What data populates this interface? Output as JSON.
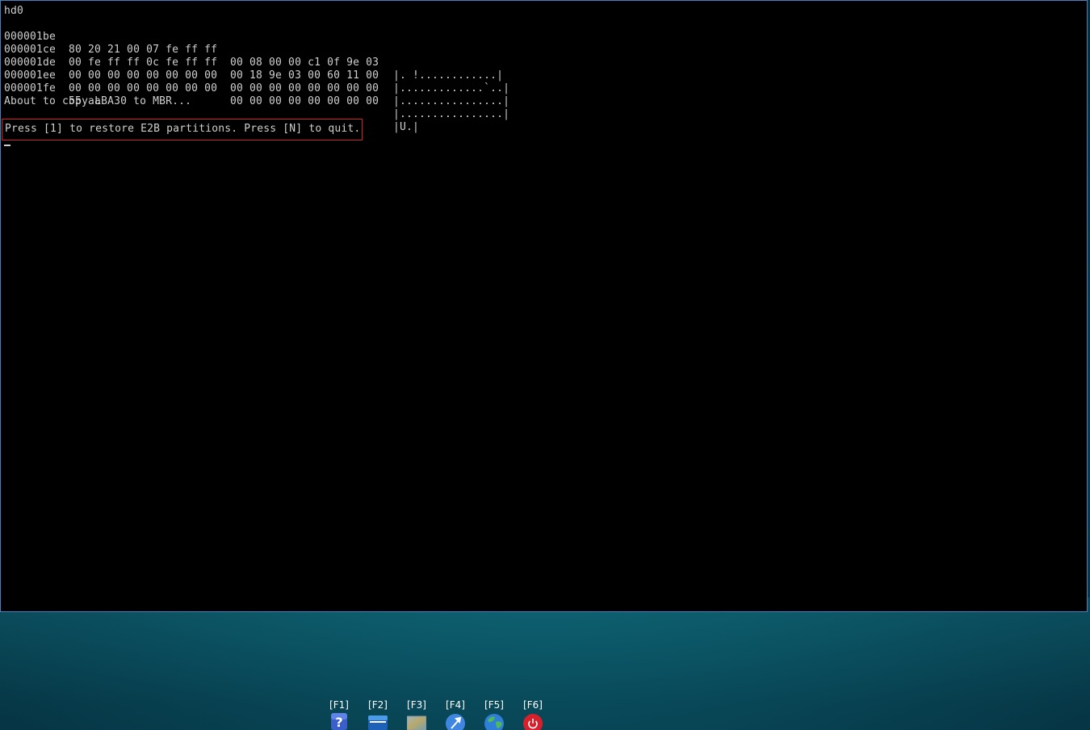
{
  "terminal": {
    "device": "hd0",
    "hexdump": [
      {
        "addr": "000001be",
        "hex1": "80 20 21 00 07 fe ff ff",
        "hex2": "00 08 00 00 c1 0f 9e 03",
        "ascii": "|. !............|"
      },
      {
        "addr": "000001ce",
        "hex1": "00 fe ff ff 0c fe ff ff",
        "hex2": "00 18 9e 03 00 60 11 00",
        "ascii": "|.............`..|"
      },
      {
        "addr": "000001de",
        "hex1": "00 00 00 00 00 00 00 00",
        "hex2": "00 00 00 00 00 00 00 00",
        "ascii": "|................|"
      },
      {
        "addr": "000001ee",
        "hex1": "00 00 00 00 00 00 00 00",
        "hex2": "00 00 00 00 00 00 00 00",
        "ascii": "|................|"
      },
      {
        "addr": "000001fe",
        "hex1": "55 aa",
        "hex2": "",
        "ascii": "|U.|"
      }
    ],
    "status_message": "About to copy LBA30 to MBR...",
    "prompt": "Press [1] to restore E2B partitions. Press [N] to quit.",
    "highlight_color": "#d42222"
  },
  "taskbar": {
    "items": [
      {
        "key": "[F1]",
        "icon": "help-icon"
      },
      {
        "key": "[F2]",
        "icon": "file-manager-icon"
      },
      {
        "key": "[F3]",
        "icon": "image-viewer-icon"
      },
      {
        "key": "[F4]",
        "icon": "tools-icon"
      },
      {
        "key": "[F5]",
        "icon": "globe-icon"
      },
      {
        "key": "[F6]",
        "icon": "power-icon"
      }
    ]
  }
}
